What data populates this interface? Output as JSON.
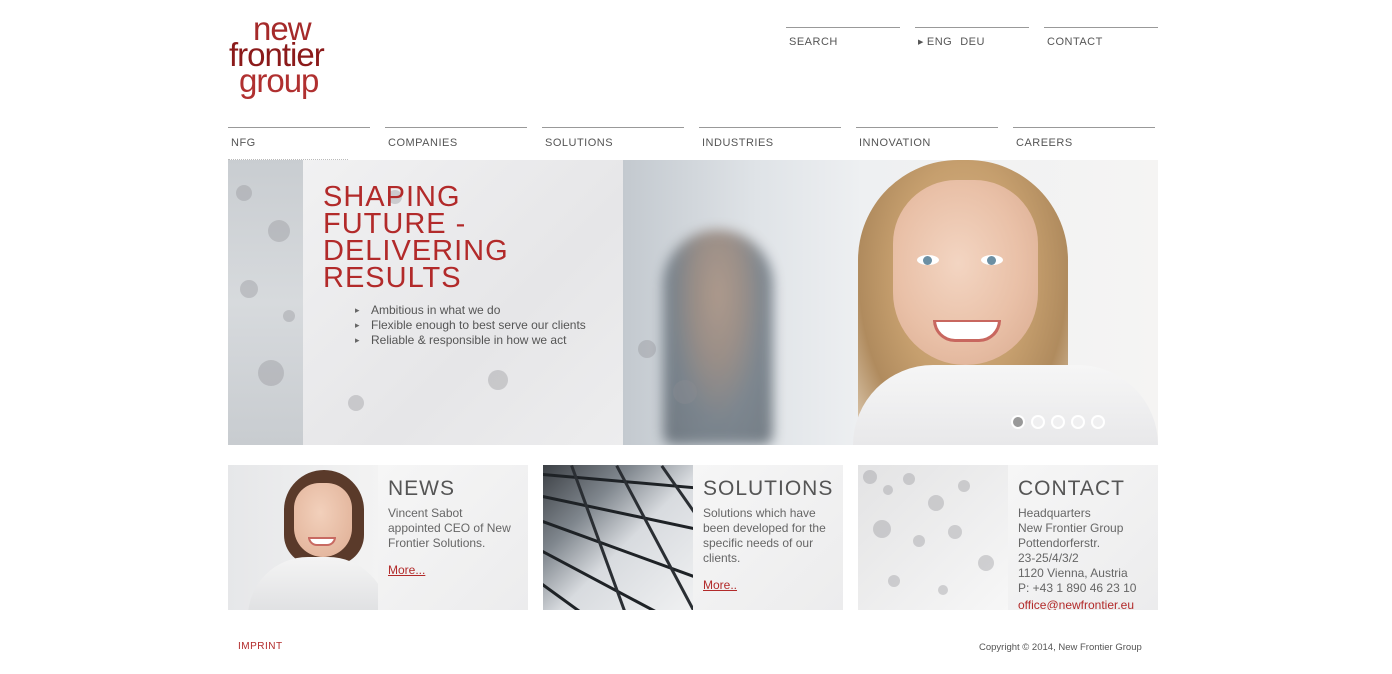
{
  "logo": {
    "line1": "new",
    "line2": "frontier",
    "line3": "group"
  },
  "utility_nav": {
    "search": "SEARCH",
    "lang_eng": "ENG",
    "lang_deu": "DEU",
    "contact": "CONTACT"
  },
  "main_nav": [
    {
      "label": "NFG",
      "active": true
    },
    {
      "label": "COMPANIES"
    },
    {
      "label": "SOLUTIONS"
    },
    {
      "label": "INDUSTRIES"
    },
    {
      "label": "INNOVATION"
    },
    {
      "label": "CAREERS"
    }
  ],
  "hero": {
    "title_line1": "SHAPING",
    "title_line2": "FUTURE -",
    "title_line3": "DELIVERING",
    "title_line4": "RESULTS",
    "bullets": [
      "Ambitious in what we do",
      "Flexible enough to best serve our clients",
      "Reliable & responsible in how we act"
    ],
    "slide_count": 5,
    "active_slide": 1
  },
  "teasers": {
    "news": {
      "title": "NEWS",
      "text": "Vincent Sabot appointed CEO of New Frontier Solutions.",
      "link": "More..."
    },
    "solutions": {
      "title": "SOLUTIONS",
      "text": "Solutions which have been developed for the specific needs of our clients.",
      "link": "More.."
    },
    "contact": {
      "title": "CONTACT",
      "line1": "Headquarters",
      "line2": "New Frontier Group",
      "line3": "Pottendorferstr.",
      "line4": "23-25/4/3/2",
      "line5": "1120 Vienna, Austria",
      "phone": "P: +43 1 890 46 23 10",
      "email": "office@newfrontier.eu"
    }
  },
  "footer": {
    "imprint": "IMPRINT",
    "copyright": "Copyright © 2014, New Frontier Group"
  },
  "colors": {
    "brand_red": "#b22a2a",
    "text_gray": "#555555",
    "rule_gray": "#999999"
  }
}
